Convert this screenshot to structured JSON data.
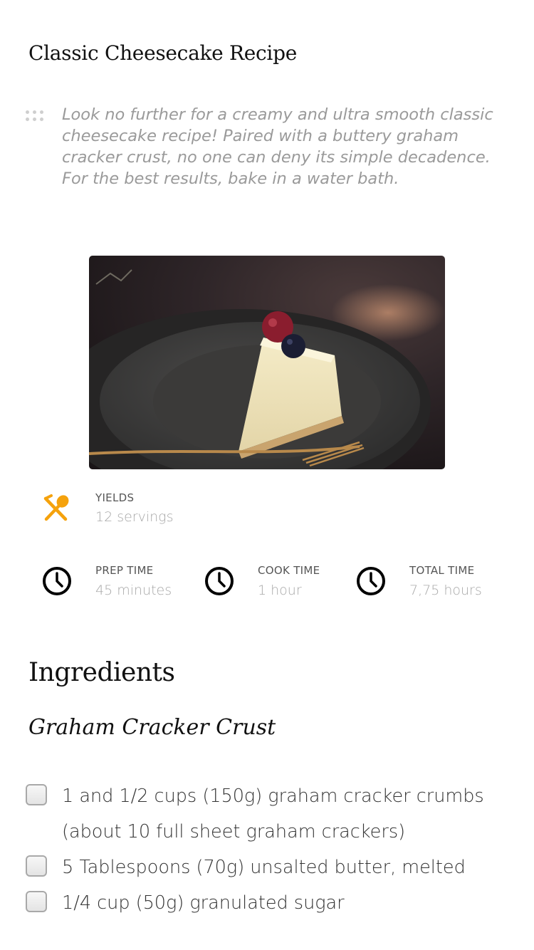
{
  "recipe": {
    "title": "Classic Cheesecake Recipe",
    "description": "Look no further for a creamy and ultra smooth classic cheesecake recipe! Paired with a buttery graham cracker crust, no one can deny its simple decadence. For the best results, bake in a water bath."
  },
  "meta": {
    "yields": {
      "label": "YIELDS",
      "value": "12 servings",
      "icon": "fork-spoon-icon"
    },
    "prep": {
      "label": "PREP TIME",
      "value": "45 minutes",
      "icon": "clock-icon"
    },
    "cook": {
      "label": "COOK TIME",
      "value": "1 hour",
      "icon": "clock-icon"
    },
    "total": {
      "label": "TOTAL TIME",
      "value": "7,75 hours",
      "icon": "clock-icon"
    }
  },
  "ingredients": {
    "heading": "Ingredients",
    "groups": [
      {
        "name": "Graham Cracker Crust",
        "items": [
          {
            "text": "1 and 1/2 cups (150g) graham cracker crumbs (about 10 full sheet graham crackers)",
            "checked": false
          },
          {
            "text": "5 Tablespoons (70g) unsalted butter, melted",
            "checked": false
          },
          {
            "text": "1/4 cup (50g) granulated sugar",
            "checked": false
          }
        ]
      }
    ]
  },
  "colors": {
    "accent": "#f5a20c",
    "text_dark": "#111111",
    "text_muted": "#a8a8a8"
  }
}
